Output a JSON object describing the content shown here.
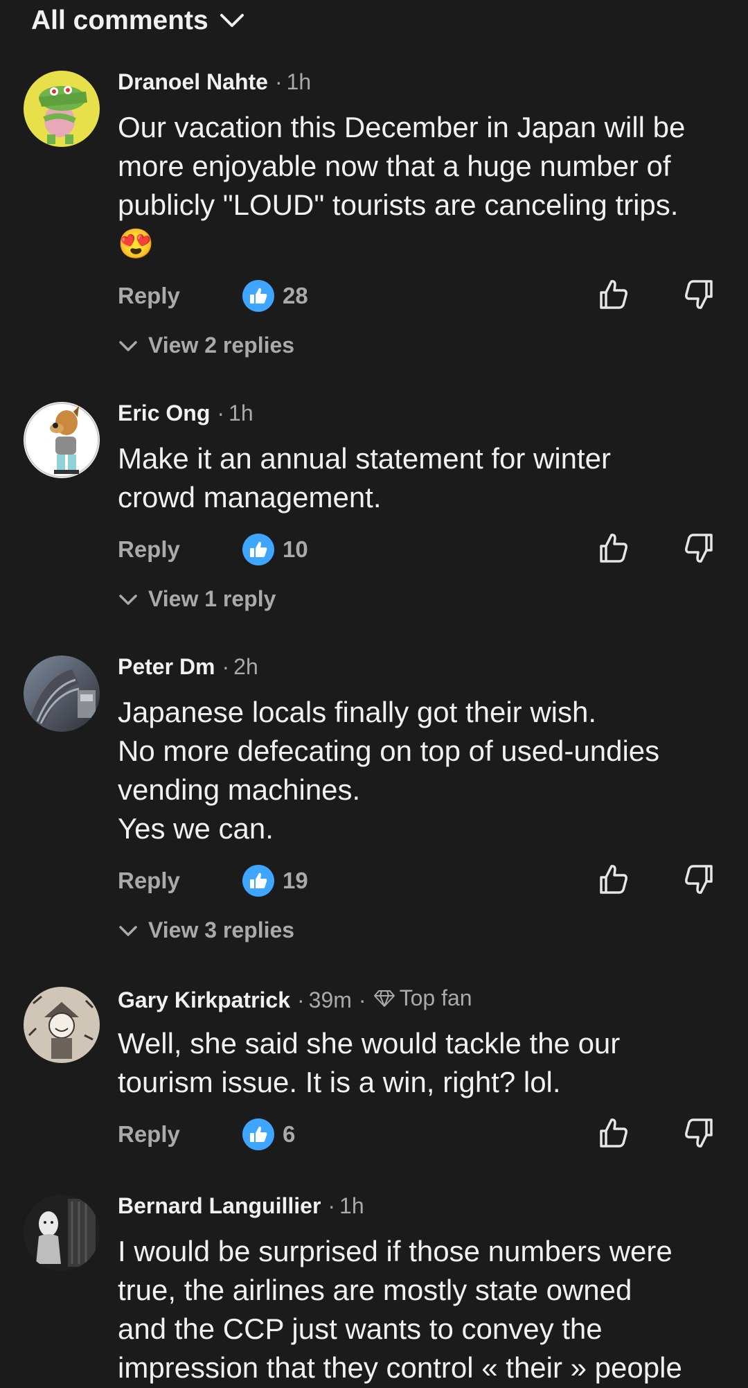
{
  "header": {
    "title": "All comments"
  },
  "comments": [
    {
      "author": "Dranoel Nahte",
      "time": "1h",
      "text": "Our vacation this December in Japan will be\nmore enjoyable now that a huge number of\npublicly \"LOUD\" tourists are canceling trips.\n😍",
      "reply_label": "Reply",
      "likes": "28",
      "view_replies": "View 2 replies"
    },
    {
      "author": "Eric Ong",
      "time": "1h",
      "text": "Make it an annual statement for winter\ncrowd management.",
      "reply_label": "Reply",
      "likes": "10",
      "view_replies": "View 1 reply"
    },
    {
      "author": "Peter Dm",
      "time": "2h",
      "text": "Japanese locals finally got their wish.\nNo more defecating on top of used-undies\nvending machines.\nYes we can.",
      "reply_label": "Reply",
      "likes": "19",
      "view_replies": "View 3 replies"
    },
    {
      "author": "Gary Kirkpatrick",
      "time": "39m",
      "badge": "Top fan",
      "text": "Well, she said she would tackle the our\ntourism issue. It is a win, right? lol.",
      "reply_label": "Reply",
      "likes": "6"
    },
    {
      "author": "Bernard Languillier",
      "time": "1h",
      "text": "I would be surprised if those numbers were\ntrue, the airlines are mostly state owned\nand the CCP just wants to convey the\nimpression that they control « their » people"
    }
  ],
  "colors": {
    "background": "#1b1b1b",
    "text": "#f1f1f1",
    "secondary": "#aaaaaa",
    "like_badge": "#3ea6ff"
  },
  "icons": {
    "header": "chevron-down-icon",
    "like_badge": "thumbs-up-filled-icon",
    "like": "thumbs-up-outline-icon",
    "dislike": "thumbs-down-outline-icon",
    "replies": "chevron-down-icon",
    "badge": "diamond-icon"
  }
}
